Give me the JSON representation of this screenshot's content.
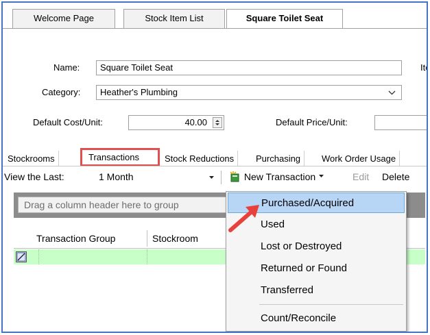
{
  "doc_tabs": [
    "Welcome Page",
    "Stock Item List",
    "Square Toilet Seat"
  ],
  "form": {
    "name_label": "Name:",
    "name_value": "Square Toilet Seat",
    "item_label_partial": "Ite",
    "category_label": "Category:",
    "category_value": "Heather's Plumbing",
    "default_cost_label": "Default Cost/Unit:",
    "default_cost_value": "40.00",
    "default_price_label": "Default Price/Unit:"
  },
  "inner_tabs": [
    "Stockrooms",
    "Transactions",
    "Stock Reductions",
    "Purchasing",
    "Work Order Usage"
  ],
  "toolbar": {
    "view_last_label": "View the Last:",
    "view_last_value": "1 Month",
    "new_transaction_label": "New Transaction",
    "edit_label": "Edit",
    "delete_label": "Delete"
  },
  "grid": {
    "group_placeholder": "Drag a column header here to group",
    "columns": [
      "Transaction Group",
      "Stockroom"
    ]
  },
  "menu": {
    "items": [
      "Purchased/Acquired",
      "Used",
      "Lost or Destroyed",
      "Returned or Found",
      "Transferred",
      "Count/Reconcile"
    ],
    "selected": "Purchased/Acquired"
  },
  "colors": {
    "frame_border": "#4472c4",
    "highlight_box": "#e05050",
    "menu_selected": "#b7d5f5",
    "grid_row": "#c8ffc8",
    "annotation_arrow": "#e8413c"
  },
  "icons": [
    "spinner-arrows-icon",
    "dropdown-chevron-icon",
    "new-transaction-icon",
    "row-edit-icon",
    "annotation-arrow-icon"
  ]
}
